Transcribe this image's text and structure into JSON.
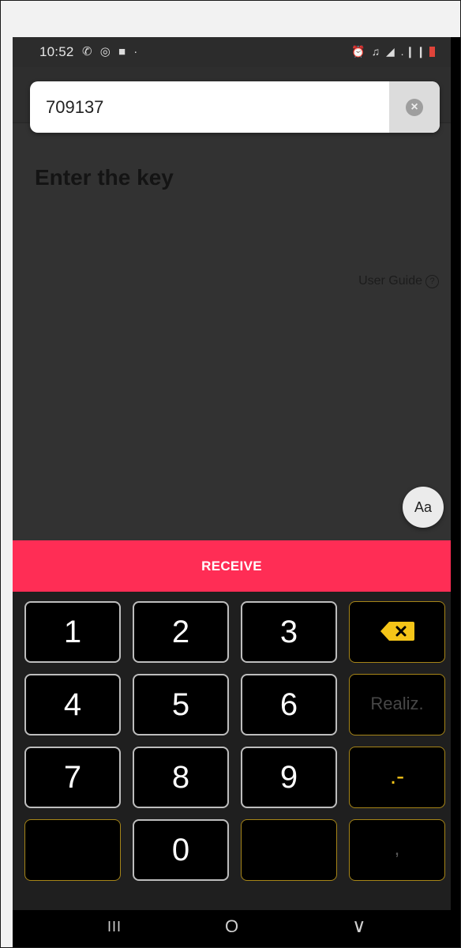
{
  "status_bar": {
    "time": "10:52",
    "left_icons": "✆ ◎ ■ ·",
    "right_icons": "⏰ ♫ ◢ .❙❙"
  },
  "search": {
    "value": "709137",
    "clear_glyph": "×"
  },
  "page": {
    "title": "Enter the key",
    "user_guide": "User Guide",
    "help_glyph": "?"
  },
  "font_toggle": {
    "label": "Aa"
  },
  "action": {
    "receive_label": "RECEIVE"
  },
  "keyboard": {
    "k1": "1",
    "k2": "2",
    "k3": "3",
    "k4": "4",
    "k5": "5",
    "k6": "6",
    "k7": "7",
    "k8": "8",
    "k9": "9",
    "k0": "0",
    "done": "Realiz.",
    "dot_minus": ".-",
    "comma": ","
  },
  "nav_bar": {
    "recent": "III",
    "home": "O",
    "back": "∨"
  },
  "colors": {
    "accent": "#ff2d55",
    "key_yellow": "#f5c518",
    "background": "#323232"
  }
}
